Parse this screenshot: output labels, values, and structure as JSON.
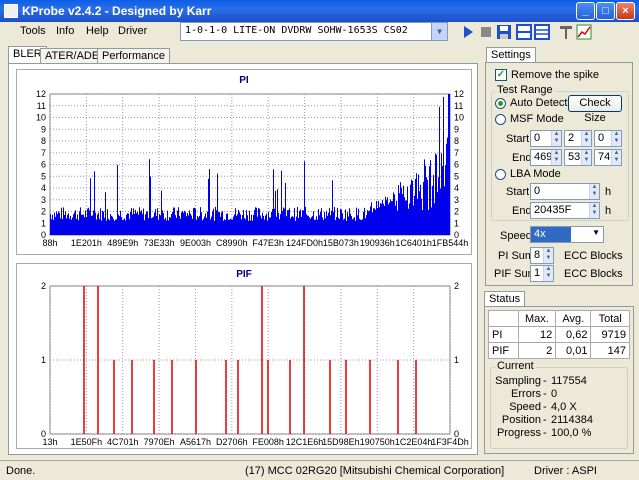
{
  "window": {
    "title": "KProbe v2.4.2 - Designed by Karr",
    "min_icon": "minimize-icon",
    "max_icon": "maximize-icon",
    "close_icon": "close-icon"
  },
  "menu": [
    "Tools",
    "Info",
    "Help",
    "Driver"
  ],
  "drive": {
    "selected": "1-0-1-0 LITE-ON DVDRW SOHW-1653S CS02"
  },
  "tabs": [
    "BLER",
    "ATER/ADER",
    "Performance"
  ],
  "pi_chart": {
    "title": "PI",
    "y_ticks": [
      "0",
      "1",
      "2",
      "3",
      "4",
      "5",
      "6",
      "7",
      "8",
      "9",
      "10",
      "11",
      "12"
    ],
    "x_ticks": [
      "88h",
      "1E201h",
      "489E9h",
      "73E33h",
      "9E003h",
      "C8990h",
      "F47E3h",
      "124FD0h",
      "15B073h",
      "190936h",
      "1C6401h",
      "1FB544h"
    ]
  },
  "pif_chart": {
    "title": "PIF",
    "y_ticks": [
      "0",
      "1",
      "2"
    ],
    "x_ticks": [
      "13h",
      "1E50Fh",
      "4C701h",
      "7970Eh",
      "A5617h",
      "D2706h",
      "FE008h",
      "12C1E6h",
      "15D98Eh",
      "190750h",
      "1C2E04h",
      "1F3F4Dh"
    ]
  },
  "chart_data": [
    {
      "type": "bar",
      "title": "PI",
      "x_range": [
        "88h",
        "1FB544h"
      ],
      "ylim": [
        0,
        12
      ],
      "x_labels": [
        "88h",
        "1E201h",
        "489E9h",
        "73E33h",
        "9E003h",
        "C8990h",
        "F47E3h",
        "124FD0h",
        "15B073h",
        "190936h",
        "1C6401h",
        "1FB544h"
      ],
      "y_max_per_block": 12,
      "y_avg": 0.62,
      "total": 9719
    },
    {
      "type": "bar",
      "title": "PIF",
      "x_range": [
        "13h",
        "1F3F4Dh"
      ],
      "ylim": [
        0,
        2
      ],
      "x_labels": [
        "13h",
        "1E50Fh",
        "4C701h",
        "7970Eh",
        "A5617h",
        "D2706h",
        "FE008h",
        "12C1E6h",
        "15D98Eh",
        "190750h",
        "1C2E04h",
        "1F3F4Dh"
      ],
      "values_at_2": 4,
      "max": 2,
      "avg": 0.01,
      "total": 147
    }
  ],
  "settings": {
    "tab": "Settings",
    "remove_spike": "Remove the spike",
    "test_range": "Test Range",
    "auto_detect": "Auto Detect",
    "check_size": "Check Size",
    "msf_mode": "MSF Mode",
    "start": "Start",
    "end": "End",
    "msf_start": [
      "0",
      "2",
      "0"
    ],
    "msf_end": [
      "469",
      "53",
      "74"
    ],
    "lba_mode": "LBA Mode",
    "lba_start": "0",
    "lba_end": "20435F",
    "h": "h",
    "speed_label": "Speed",
    "speed_value": "4x",
    "pi_sum_label": "PI Sum",
    "pi_sum_value": "8",
    "pif_sum_label": "PIF Sum",
    "pif_sum_value": "1",
    "ecc_blocks": "ECC Blocks"
  },
  "status": {
    "tab": "Status",
    "headers": [
      "",
      "Max.",
      "Avg.",
      "Total"
    ],
    "rows": [
      [
        "PI",
        "12",
        "0,62",
        "9719"
      ],
      [
        "PIF",
        "2",
        "0,01",
        "147"
      ]
    ],
    "current_title": "Current",
    "current": [
      {
        "label": "Sampling",
        "value": "117554"
      },
      {
        "label": "Errors",
        "value": "0"
      },
      {
        "label": "Speed",
        "value": "4,0  X"
      },
      {
        "label": "Position",
        "value": "2114384"
      },
      {
        "label": "Progress",
        "value": "100,0 %"
      }
    ]
  },
  "statusbar": {
    "left": "Done.",
    "disc": "(17) MCC 02RG20  [Mitsubishi Chemical Corporation]",
    "driver": "Driver : ASPI"
  }
}
